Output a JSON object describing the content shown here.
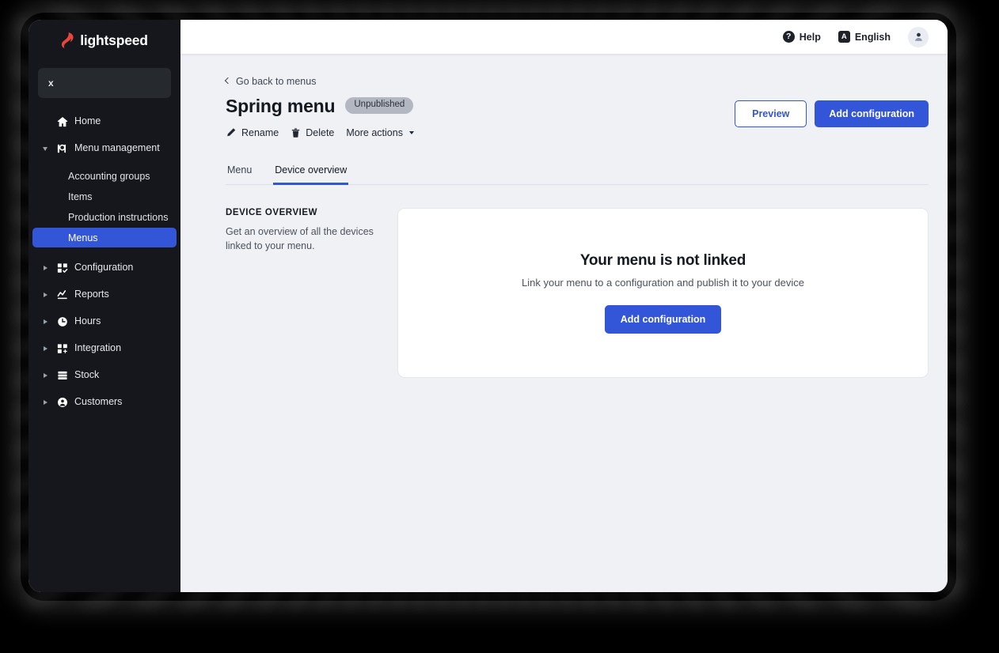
{
  "brand": {
    "name": "lightspeed",
    "logo_icon": "flame-icon"
  },
  "sidebar": {
    "search": {
      "value": "x",
      "icon": "search-input"
    },
    "items": [
      {
        "label": "Home",
        "icon": "home-icon",
        "caret": "none"
      },
      {
        "label": "Menu management",
        "icon": "menu-management-icon",
        "caret": "down"
      },
      {
        "label": "Configuration",
        "icon": "configuration-icon",
        "caret": "right"
      },
      {
        "label": "Reports",
        "icon": "reports-icon",
        "caret": "right"
      },
      {
        "label": "Hours",
        "icon": "clock-icon",
        "caret": "right"
      },
      {
        "label": "Integration",
        "icon": "integration-icon",
        "caret": "right"
      },
      {
        "label": "Stock",
        "icon": "stock-icon",
        "caret": "right"
      },
      {
        "label": "Customers",
        "icon": "customers-icon",
        "caret": "right"
      }
    ],
    "submenu": [
      {
        "label": "Accounting groups",
        "active": false
      },
      {
        "label": "Items",
        "active": false
      },
      {
        "label": "Production instructions",
        "active": false
      },
      {
        "label": "Menus",
        "active": true
      }
    ]
  },
  "topbar": {
    "help_label": "Help",
    "help_icon": "question-mark-icon",
    "language_label": "English",
    "language_icon": "translate-icon",
    "avatar_icon": "user-avatar-icon"
  },
  "page": {
    "back_link": "Go back to menus",
    "back_icon": "chevron-left-icon",
    "title": "Spring menu",
    "status_badge": "Unpublished",
    "actions": [
      {
        "label": "Rename",
        "icon": "pencil-icon"
      },
      {
        "label": "Delete",
        "icon": "trash-icon"
      },
      {
        "label": "More actions",
        "icon": "chevron-down-icon"
      }
    ],
    "preview_button": "Preview",
    "add_configuration_button": "Add configuration",
    "tabs": [
      {
        "label": "Menu",
        "active": false
      },
      {
        "label": "Device overview",
        "active": true
      }
    ]
  },
  "device_overview": {
    "section_title": "DEVICE OVERVIEW",
    "section_description": "Get an overview of all the devices linked to your menu.",
    "empty_title": "Your menu is not linked",
    "empty_subtitle": "Link your menu to a configuration and publish it to your device",
    "empty_button": "Add configuration"
  },
  "colors": {
    "accent_blue": "#3355d8",
    "sidebar_bg": "#15171c",
    "page_bg": "#eff1f5",
    "badge_gray": "#b2b7c2",
    "brand_red": "#e8453c"
  }
}
